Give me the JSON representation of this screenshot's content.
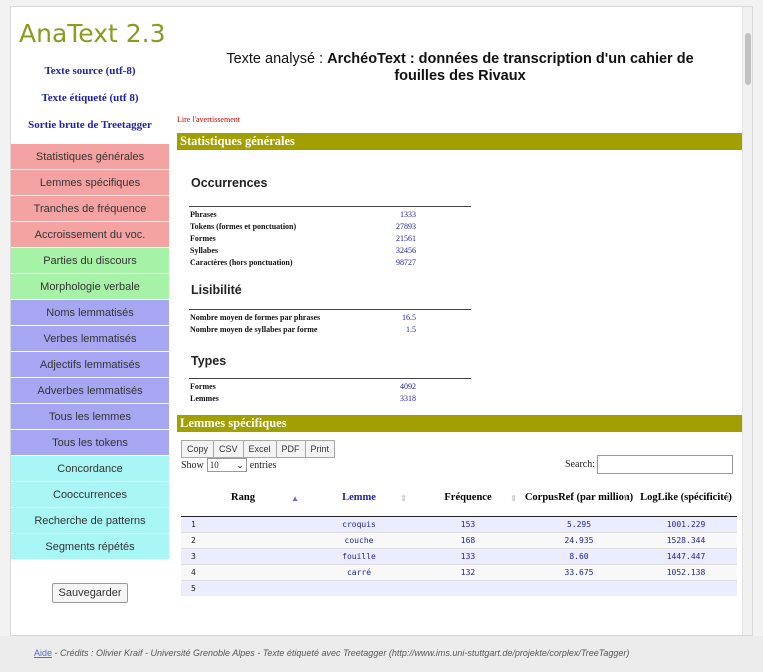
{
  "app": {
    "title": "AnaText 2.3"
  },
  "sidebar": {
    "links": [
      "Texte source (utf-8)",
      "Texte étiqueté (utf 8)",
      "Sortie brute de Treetagger"
    ],
    "menu": [
      {
        "label": "Statistiques générales",
        "color": "red"
      },
      {
        "label": "Lemmes spécifiques",
        "color": "red"
      },
      {
        "label": "Tranches de fréquence",
        "color": "red"
      },
      {
        "label": "Accroissement du voc.",
        "color": "red"
      },
      {
        "label": "Parties du discours",
        "color": "green"
      },
      {
        "label": "Morphologie verbale",
        "color": "green"
      },
      {
        "label": "Noms lemmatisés",
        "color": "blue"
      },
      {
        "label": "Verbes lemmatisés",
        "color": "blue"
      },
      {
        "label": "Adjectifs lemmatisés",
        "color": "blue"
      },
      {
        "label": "Adverbes lemmatisés",
        "color": "blue"
      },
      {
        "label": "Tous les lemmes",
        "color": "blue"
      },
      {
        "label": "Tous les tokens",
        "color": "blue"
      },
      {
        "label": "Concordance",
        "color": "cyan"
      },
      {
        "label": "Cooccurrences",
        "color": "cyan"
      },
      {
        "label": "Recherche de patterns",
        "color": "cyan"
      },
      {
        "label": "Segments répétés",
        "color": "cyan"
      }
    ],
    "save_label": "Sauvegarder"
  },
  "header": {
    "prefix": "Texte analysé : ",
    "title_line1": "ArchéoText : données de transcription d'un cahier de",
    "title_line2": "fouilles des Rivaux"
  },
  "warning_link": "Lire l'avertissement",
  "sections": {
    "stats_title": "Statistiques générales",
    "specific_title": "Lemmes spécifiques"
  },
  "occurrences": {
    "heading": "Occurrences",
    "rows": [
      {
        "label": "Phrases",
        "value": "1333"
      },
      {
        "label": "Tokens (formes et ponctuation)",
        "value": "27893"
      },
      {
        "label": "Formes",
        "value": "21561"
      },
      {
        "label": "Syllabes",
        "value": "32456"
      },
      {
        "label": "Caractères (hors ponctuation)",
        "value": "98727"
      }
    ]
  },
  "lisibilite": {
    "heading": "Lisibilité",
    "rows": [
      {
        "label": "Nombre moyen de formes par phrases",
        "value": "16.5"
      },
      {
        "label": "Nombre moyen de syllabes par forme",
        "value": "1.5"
      }
    ]
  },
  "types": {
    "heading": "Types",
    "rows": [
      {
        "label": "Formes",
        "value": "4092"
      },
      {
        "label": "Lemmes",
        "value": "3318"
      }
    ]
  },
  "table_controls": {
    "buttons": [
      "Copy",
      "CSV",
      "Excel",
      "PDF",
      "Print"
    ],
    "show_label": "Show",
    "entries_value": "10",
    "entries_label": "entries",
    "search_label": "Search:"
  },
  "table": {
    "headers": [
      "Rang",
      "Lemme",
      "Fréquence",
      "CorpusRef (par million)",
      "LogLike (spécificité)"
    ],
    "rows": [
      [
        "1",
        "croquis",
        "153",
        "5.295",
        "1001.229"
      ],
      [
        "2",
        "couche",
        "168",
        "24.935",
        "1528.344"
      ],
      [
        "3",
        "fouille",
        "133",
        "8.60",
        "1447.447"
      ],
      [
        "4",
        "carré",
        "132",
        "33.675",
        "1052.138"
      ],
      [
        "5",
        "",
        "",
        "",
        ""
      ]
    ]
  },
  "footer": {
    "aide": "Aide",
    "text": " - Crédits : Olivier Kraif - Université Grenoble Alpes - Texte étiqueté avec Treetagger (http://www.ims.uni-stuttgart.de/projekte/corplex/TreeTagger)"
  }
}
